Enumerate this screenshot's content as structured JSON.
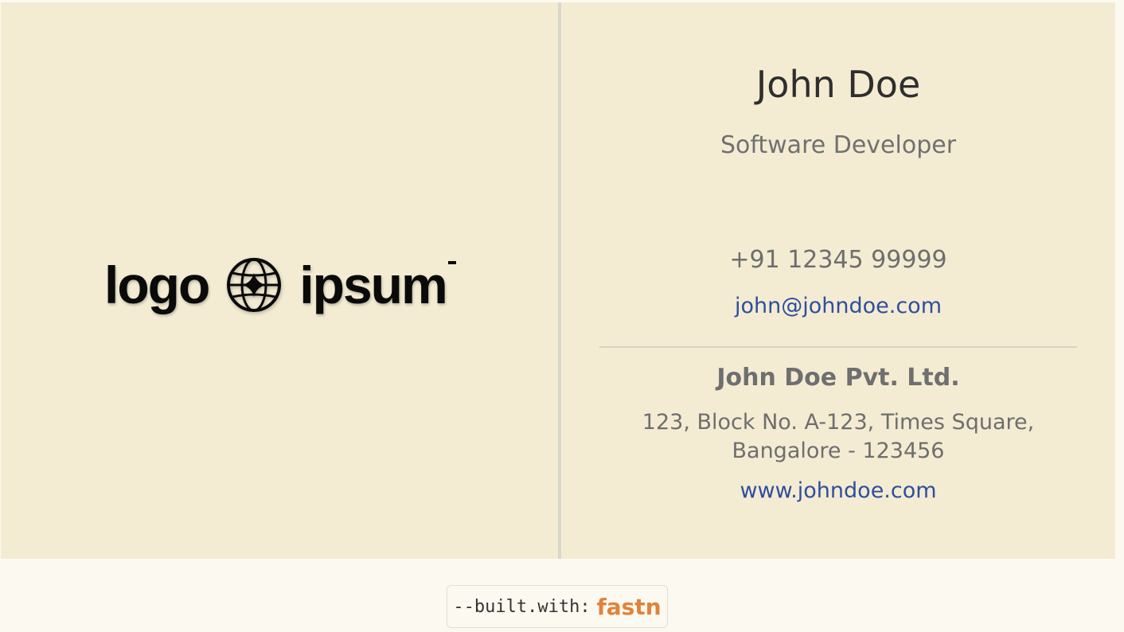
{
  "logo": {
    "word_left": "logo",
    "word_right": "ipsum",
    "icon": "globe-sparkle-icon"
  },
  "contact": {
    "name": "John Doe",
    "title": "Software Developer",
    "phone": "+91 12345 99999",
    "email": "john@johndoe.com"
  },
  "company": {
    "name": "John Doe Pvt. Ltd.",
    "address_line1": "123, Block No. A-123, Times Square,",
    "address_line2": "Bangalore - 123456",
    "website": "www.johndoe.com"
  },
  "footer": {
    "prefix": "--built.with:",
    "brand": "fastn"
  },
  "colors": {
    "card_background": "#f3ecd3",
    "page_background": "#fcf9f0",
    "link": "#2f4e9c",
    "brand_accent": "#e0833a"
  }
}
